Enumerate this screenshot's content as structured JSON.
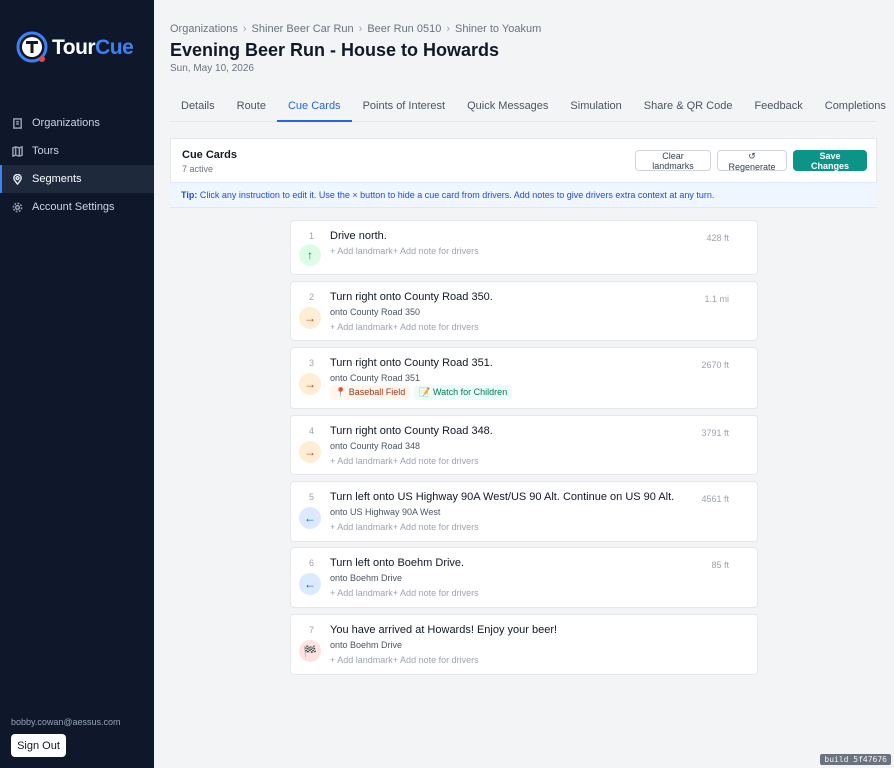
{
  "brand": {
    "tour": "Tour",
    "cue": "Cue"
  },
  "sidebar": {
    "items": [
      {
        "label": "Organizations",
        "icon": "building-icon"
      },
      {
        "label": "Tours",
        "icon": "map-icon"
      },
      {
        "label": "Segments",
        "icon": "pin-icon",
        "active": true
      },
      {
        "label": "Account Settings",
        "icon": "gear-icon"
      }
    ],
    "user_email": "bobby.cowan@aessus.com",
    "sign_out_label": "Sign Out"
  },
  "breadcrumb": [
    "Organizations",
    "Shiner Beer Car Run",
    "Beer Run 0510",
    "Shiner to Yoakum"
  ],
  "page": {
    "title": "Evening Beer Run - House to Howards",
    "date": "Sun, May 10, 2026"
  },
  "tabs": [
    {
      "label": "Details"
    },
    {
      "label": "Route"
    },
    {
      "label": "Cue Cards",
      "active": true
    },
    {
      "label": "Points of Interest"
    },
    {
      "label": "Quick Messages"
    },
    {
      "label": "Simulation"
    },
    {
      "label": "Share & QR Code"
    },
    {
      "label": "Feedback"
    },
    {
      "label": "Completions"
    }
  ],
  "panel": {
    "title": "Cue Cards",
    "subtitle": "7 active",
    "clear_label": "Clear landmarks",
    "regenerate_label": "↺ Regenerate",
    "save_label": "Save Changes"
  },
  "tip": {
    "prefix": "Tip:",
    "text": "Click any instruction to edit it. Use the × button to hide a cue card from drivers. Add notes to give drivers extra context at any turn."
  },
  "add_landmark_label": "+ Add landmark",
  "add_note_label": "+ Add note for drivers",
  "cue_cards": [
    {
      "num": "1",
      "instruction": "Drive north.",
      "onto": "",
      "distance": "428 ft",
      "icon": "arrow-up-icon",
      "glyph": "↑"
    },
    {
      "num": "2",
      "instruction": "Turn right onto County Road 350.",
      "onto": "onto County Road 350",
      "distance": "1.1 mi",
      "icon": "arrow-right-icon",
      "glyph": "→"
    },
    {
      "num": "3",
      "instruction": "Turn right onto County Road 351.",
      "onto": "onto County Road 351",
      "distance": "2670 ft",
      "icon": "arrow-right-icon",
      "glyph": "→",
      "landmark": "Baseball Field",
      "note": "Watch for Children"
    },
    {
      "num": "4",
      "instruction": "Turn right onto County Road 348.",
      "onto": "onto County Road 348",
      "distance": "3791 ft",
      "icon": "arrow-right-icon",
      "glyph": "→"
    },
    {
      "num": "5",
      "instruction": "Turn left onto US Highway 90A West/US 90 Alt. Continue on US 90 Alt.",
      "onto": "onto US Highway 90A West",
      "distance": "4561 ft",
      "icon": "arrow-left-icon",
      "glyph": "←"
    },
    {
      "num": "6",
      "instruction": "Turn left onto Boehm Drive.",
      "onto": "onto Boehm Drive",
      "distance": "85 ft",
      "icon": "arrow-left-icon",
      "glyph": "←"
    },
    {
      "num": "7",
      "instruction": "You have arrived at Howards! Enjoy your beer!",
      "onto": "onto Boehm Drive",
      "distance": "",
      "icon": "finish-flag-icon",
      "glyph": "🏁"
    }
  ],
  "build": "build 5f47676"
}
